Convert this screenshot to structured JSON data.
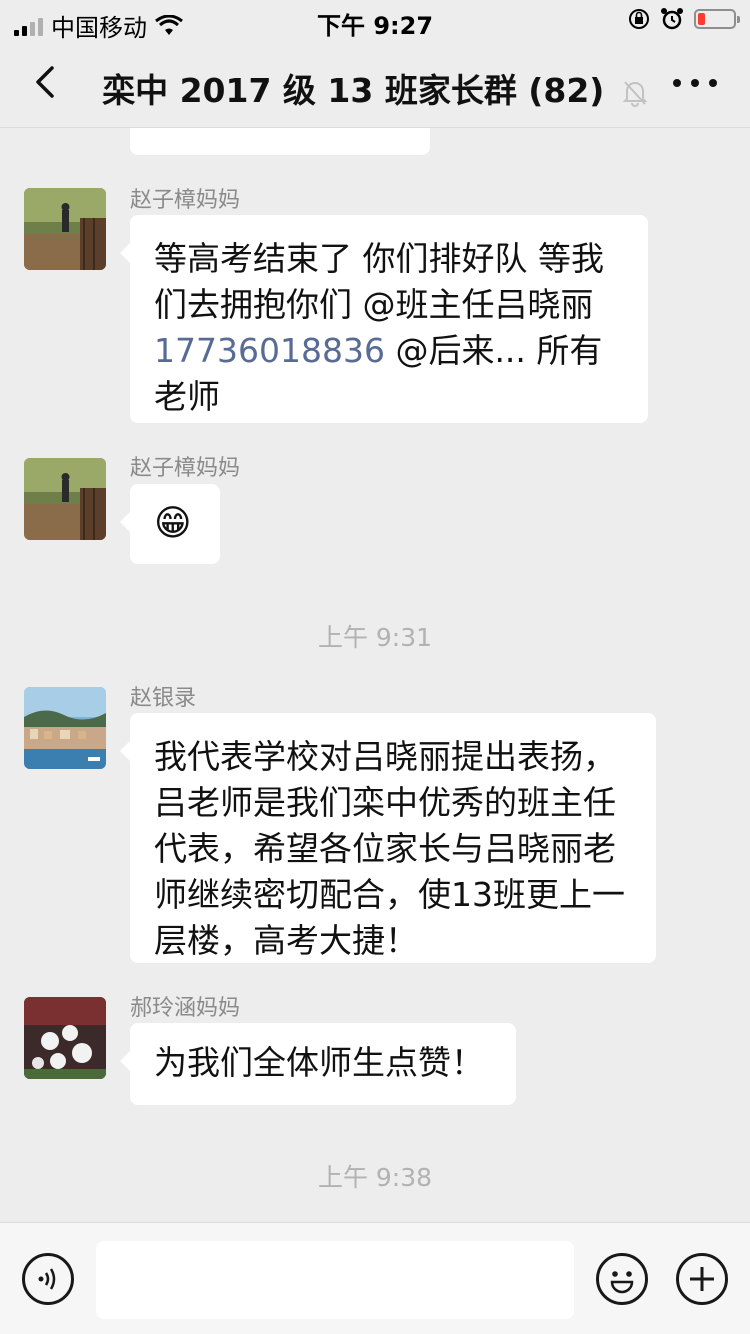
{
  "status_bar": {
    "carrier": "中国移动",
    "time": "下午 9:27",
    "battery_color": "#ff3b30"
  },
  "nav": {
    "title": "栾中 2017 级 13 班家长群 (82)",
    "back_icon": "chevron-left-icon",
    "mute_icon": "bell-muted-icon",
    "more_icon": "more-dots-icon"
  },
  "messages": [
    {
      "sender": "赵子樟妈妈",
      "text_before_link": "等高考结束了 你们排好队 等我们去拥抱你们 @班主任吕晓丽",
      "phone": "17736018836",
      "text_after_link": " @后来... 所有老师"
    },
    {
      "sender": "赵子樟妈妈",
      "emoji": "😁"
    },
    {
      "timestamp": "上午 9:31"
    },
    {
      "sender": "赵银录",
      "text": "我代表学校对吕晓丽提出表扬，吕老师是我们栾中优秀的班主任代表，希望各位家长与吕晓丽老师继续密切配合，使13班更上一层楼，高考大捷！"
    },
    {
      "sender": "郝玲涵妈妈",
      "text": "为我们全体师生点赞！"
    },
    {
      "timestamp": "上午 9:38"
    }
  ],
  "input_bar": {
    "voice_icon": "voice-icon",
    "emoji_icon": "emoji-icon",
    "plus_icon": "plus-icon",
    "input_value": ""
  },
  "colors": {
    "background": "#ededed",
    "bubble": "#ffffff",
    "link": "#576b95",
    "timestamp": "#b2b2b2"
  }
}
